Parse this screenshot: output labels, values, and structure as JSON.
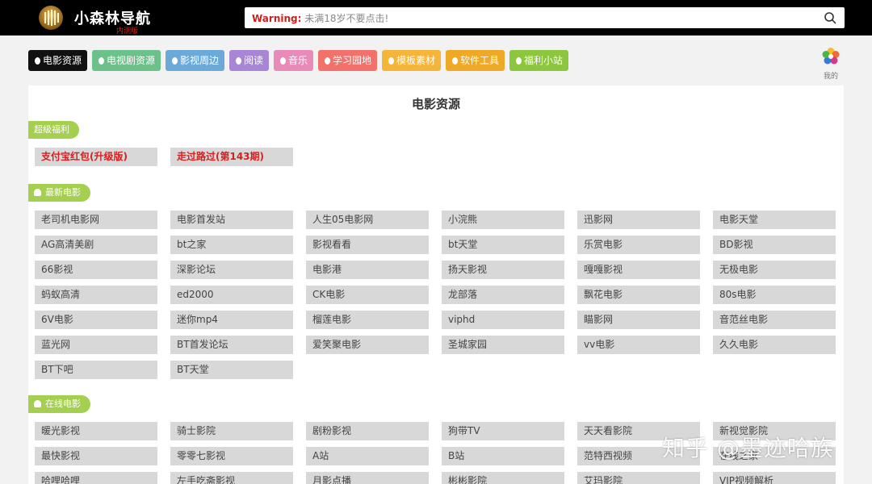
{
  "header": {
    "logo_text": "小森林导航",
    "logo_sub": "内测版",
    "search_warning": "Warning:",
    "search_text": "未满18岁不要点击!"
  },
  "tabs": [
    {
      "label": "电影资源",
      "color": "#111111",
      "active": true
    },
    {
      "label": "电视剧资源",
      "color": "#6cc08a"
    },
    {
      "label": "影视周边",
      "color": "#6aa9d8"
    },
    {
      "label": "阅读",
      "color": "#a985d6"
    },
    {
      "label": "音乐",
      "color": "#e98bb9"
    },
    {
      "label": "学习园地",
      "color": "#f2726b"
    },
    {
      "label": "模板素材",
      "color": "#f5b53a"
    },
    {
      "label": "软件工具",
      "color": "#efa926"
    },
    {
      "label": "福利小站",
      "color": "#8cc63f"
    }
  ],
  "me_label": "我的",
  "card_title": "电影资源",
  "sections": [
    {
      "title": "超级福利",
      "links": [
        "支付宝红包(升级版)",
        "走过路过(第143期)"
      ]
    },
    {
      "title": "最新电影",
      "links": [
        "老司机电影网",
        "电影首发站",
        "人生05电影网",
        "小浣熊",
        "迅影网",
        "电影天堂",
        "AG高清美剧",
        "bt之家",
        "影视看看",
        "bt天堂",
        "乐赏电影",
        "BD影视",
        "66影视",
        "深影论坛",
        "电影港",
        "扬天影视",
        "嘎嘎影视",
        "无极电影",
        "蚂蚁高清",
        "ed2000",
        "CK电影",
        "龙部落",
        "飘花电影",
        "80s电影",
        "6V电影",
        "迷你mp4",
        "榴莲电影",
        "viphd",
        "瞄影网",
        "音范丝电影",
        "蓝光网",
        "BT首发论坛",
        "爱笑聚电影",
        "圣城家园",
        "vv电影",
        "久久电影",
        "BT下吧",
        "BT天堂"
      ]
    },
    {
      "title": "在线电影",
      "links": [
        "暖光影视",
        "骑士影院",
        "剧粉影视",
        "狗带TV",
        "天天看影院",
        "新视觉影院",
        "最快影视",
        "零零七影视",
        "A站",
        "B站",
        "范特西视频",
        "在线之家",
        "哈哩哈哩",
        "左手吃斋影视",
        "月影点播",
        "彬彬影院",
        "艾玛影院",
        "VIP视频解析"
      ]
    }
  ],
  "watermark": "知乎 @墨迹哈族",
  "colors": {
    "section_badge": "#a5cf4f",
    "link_bg": "#d8d8d8",
    "warning": "#cc1f1f"
  }
}
